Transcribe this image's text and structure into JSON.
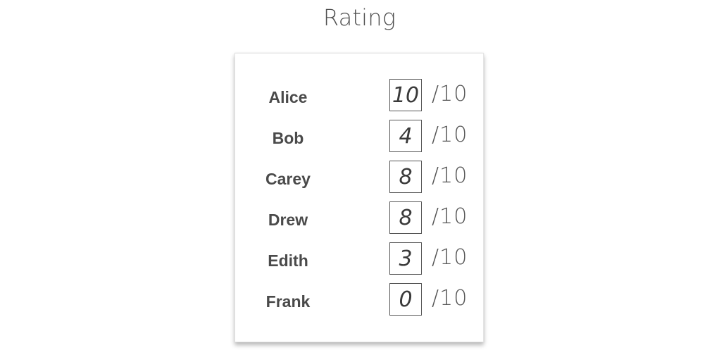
{
  "title": "Rating",
  "ratings": [
    {
      "name": "Alice",
      "score": "10",
      "max": "/10"
    },
    {
      "name": "Bob",
      "score": "4",
      "max": "/10"
    },
    {
      "name": "Carey",
      "score": "8",
      "max": "/10"
    },
    {
      "name": "Drew",
      "score": "8",
      "max": "/10"
    },
    {
      "name": "Edith",
      "score": "3",
      "max": "/10"
    },
    {
      "name": "Frank",
      "score": "0",
      "max": "/10"
    }
  ]
}
